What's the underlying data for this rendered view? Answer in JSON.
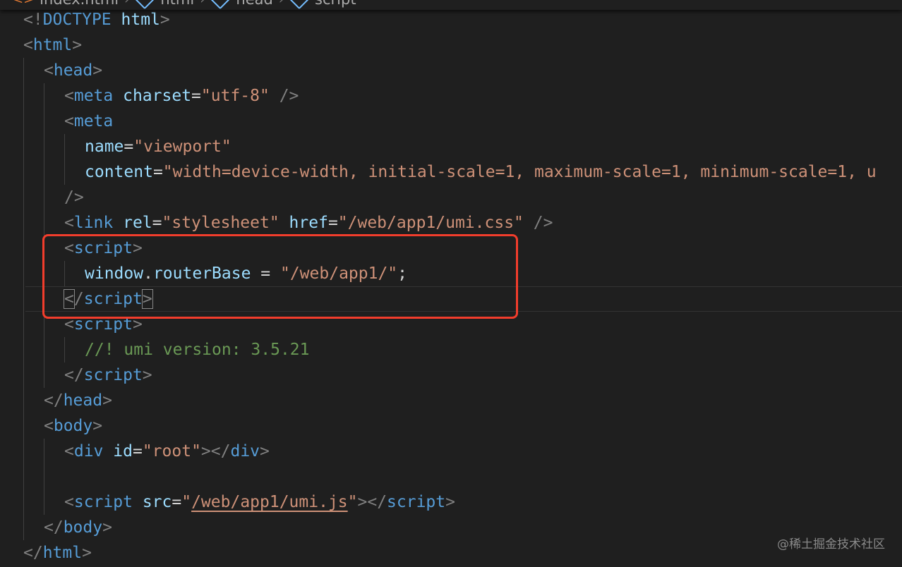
{
  "breadcrumb": {
    "file": "index.html",
    "node1": "html",
    "node2": "head",
    "node3": "script"
  },
  "lines": [
    {
      "tokens": [
        {
          "k": "p",
          "v": "<!"
        },
        {
          "k": "t",
          "v": "DOCTYPE"
        },
        {
          "k": "w",
          "v": " "
        },
        {
          "k": "a",
          "v": "html"
        },
        {
          "k": "p",
          "v": ">"
        }
      ]
    },
    {
      "tokens": [
        {
          "k": "p",
          "v": "<"
        },
        {
          "k": "t",
          "v": "html"
        },
        {
          "k": "p",
          "v": ">"
        }
      ]
    },
    {
      "tokens": [
        {
          "k": "p",
          "v": "<"
        },
        {
          "k": "t",
          "v": "head"
        },
        {
          "k": "p",
          "v": ">"
        }
      ]
    },
    {
      "tokens": [
        {
          "k": "p",
          "v": "<"
        },
        {
          "k": "t",
          "v": "meta"
        },
        {
          "k": "w",
          "v": " "
        },
        {
          "k": "a",
          "v": "charset"
        },
        {
          "k": "w",
          "v": "="
        },
        {
          "k": "s",
          "v": "\"utf-8\""
        },
        {
          "k": "w",
          "v": " "
        },
        {
          "k": "p",
          "v": "/>"
        }
      ]
    },
    {
      "tokens": [
        {
          "k": "p",
          "v": "<"
        },
        {
          "k": "t",
          "v": "meta"
        }
      ]
    },
    {
      "tokens": [
        {
          "k": "a",
          "v": "name"
        },
        {
          "k": "w",
          "v": "="
        },
        {
          "k": "s",
          "v": "\"viewport\""
        }
      ]
    },
    {
      "tokens": [
        {
          "k": "a",
          "v": "content"
        },
        {
          "k": "w",
          "v": "="
        },
        {
          "k": "s",
          "v": "\"width=device-width, initial-scale=1, maximum-scale=1, minimum-scale=1, u"
        }
      ]
    },
    {
      "tokens": [
        {
          "k": "p",
          "v": "/>"
        }
      ]
    },
    {
      "tokens": [
        {
          "k": "p",
          "v": "<"
        },
        {
          "k": "t",
          "v": "link"
        },
        {
          "k": "w",
          "v": " "
        },
        {
          "k": "a",
          "v": "rel"
        },
        {
          "k": "w",
          "v": "="
        },
        {
          "k": "s",
          "v": "\"stylesheet\""
        },
        {
          "k": "w",
          "v": " "
        },
        {
          "k": "a",
          "v": "href"
        },
        {
          "k": "w",
          "v": "="
        },
        {
          "k": "s",
          "v": "\"/web/app1/umi.css\""
        },
        {
          "k": "w",
          "v": " "
        },
        {
          "k": "p",
          "v": "/>"
        }
      ]
    },
    {
      "tokens": [
        {
          "k": "p",
          "v": "<"
        },
        {
          "k": "t",
          "v": "script"
        },
        {
          "k": "p",
          "v": ">"
        }
      ]
    },
    {
      "tokens": [
        {
          "k": "a",
          "v": "window"
        },
        {
          "k": "w",
          "v": "."
        },
        {
          "k": "a",
          "v": "routerBase"
        },
        {
          "k": "w",
          "v": " = "
        },
        {
          "k": "s",
          "v": "\"/web/app1/\""
        },
        {
          "k": "w",
          "v": ";"
        }
      ]
    },
    {
      "tokens": [
        {
          "k": "p",
          "v": "<",
          "m": "bm"
        },
        {
          "k": "p",
          "v": "/"
        },
        {
          "k": "t",
          "v": "script"
        },
        {
          "k": "p",
          "v": ">",
          "m": "bm"
        }
      ]
    },
    {
      "tokens": [
        {
          "k": "p",
          "v": "<"
        },
        {
          "k": "t",
          "v": "script"
        },
        {
          "k": "p",
          "v": ">"
        }
      ]
    },
    {
      "tokens": [
        {
          "k": "c",
          "v": "//! umi version: 3.5.21"
        }
      ]
    },
    {
      "tokens": [
        {
          "k": "p",
          "v": "</"
        },
        {
          "k": "t",
          "v": "script"
        },
        {
          "k": "p",
          "v": ">"
        }
      ]
    },
    {
      "tokens": [
        {
          "k": "p",
          "v": "</"
        },
        {
          "k": "t",
          "v": "head"
        },
        {
          "k": "p",
          "v": ">"
        }
      ]
    },
    {
      "tokens": [
        {
          "k": "p",
          "v": "<"
        },
        {
          "k": "t",
          "v": "body"
        },
        {
          "k": "p",
          "v": ">"
        }
      ]
    },
    {
      "tokens": [
        {
          "k": "p",
          "v": "<"
        },
        {
          "k": "t",
          "v": "div"
        },
        {
          "k": "w",
          "v": " "
        },
        {
          "k": "a",
          "v": "id"
        },
        {
          "k": "w",
          "v": "="
        },
        {
          "k": "s",
          "v": "\"root\""
        },
        {
          "k": "p",
          "v": "></"
        },
        {
          "k": "t",
          "v": "div"
        },
        {
          "k": "p",
          "v": ">"
        }
      ]
    },
    {
      "tokens": []
    },
    {
      "tokens": [
        {
          "k": "p",
          "v": "<"
        },
        {
          "k": "t",
          "v": "script"
        },
        {
          "k": "w",
          "v": " "
        },
        {
          "k": "a",
          "v": "src"
        },
        {
          "k": "w",
          "v": "="
        },
        {
          "k": "s",
          "v": "\""
        },
        {
          "k": "s",
          "v": "/web/app1/umi.js",
          "m": "ul"
        },
        {
          "k": "s",
          "v": "\""
        },
        {
          "k": "p",
          "v": "></"
        },
        {
          "k": "t",
          "v": "script"
        },
        {
          "k": "p",
          "v": ">"
        }
      ]
    },
    {
      "tokens": [
        {
          "k": "p",
          "v": "</"
        },
        {
          "k": "t",
          "v": "body"
        },
        {
          "k": "p",
          "v": ">"
        }
      ]
    },
    {
      "tokens": [
        {
          "k": "p",
          "v": "</"
        },
        {
          "k": "t",
          "v": "html"
        },
        {
          "k": "p",
          "v": ">"
        }
      ]
    }
  ],
  "watermark": "@稀土掘金技术社区",
  "colors": {
    "highlight_box": "#f23d2c",
    "tag": "#569cd6",
    "attribute": "#9cdcfe",
    "string": "#ce9178",
    "comment": "#6a9955",
    "punctuation": "#808080"
  }
}
